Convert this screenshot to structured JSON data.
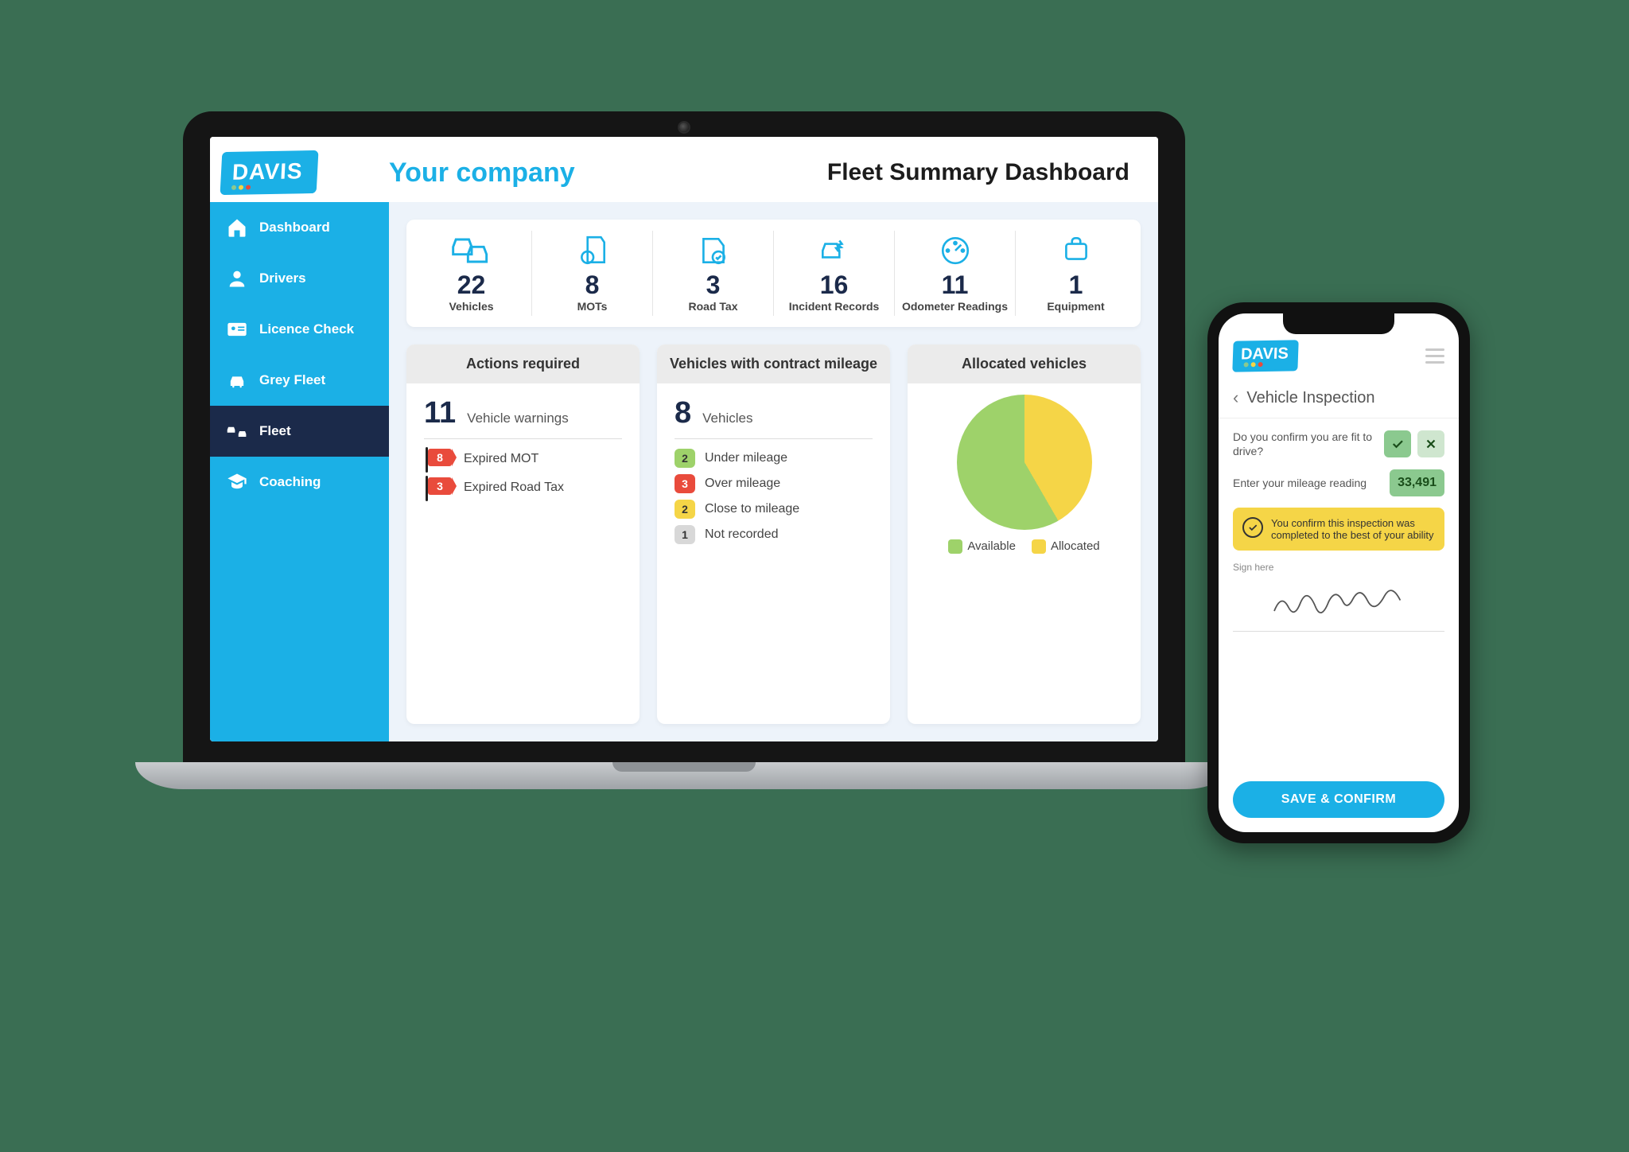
{
  "brand": "DAVIS",
  "header": {
    "company": "Your company",
    "page_title": "Fleet Summary Dashboard"
  },
  "sidebar": {
    "items": [
      {
        "label": "Dashboard",
        "icon": "home"
      },
      {
        "label": "Drivers",
        "icon": "user"
      },
      {
        "label": "Licence Check",
        "icon": "id-card"
      },
      {
        "label": "Grey Fleet",
        "icon": "car"
      },
      {
        "label": "Fleet",
        "icon": "cars",
        "active": true
      },
      {
        "label": "Coaching",
        "icon": "graduation"
      }
    ]
  },
  "stats": [
    {
      "value": "22",
      "label": "Vehicles",
      "icon": "vehicles"
    },
    {
      "value": "8",
      "label": "MOTs",
      "icon": "mot"
    },
    {
      "value": "3",
      "label": "Road Tax",
      "icon": "road-tax"
    },
    {
      "value": "16",
      "label": "Incident Records",
      "icon": "incident"
    },
    {
      "value": "11",
      "label": "Odometer Readings",
      "icon": "odometer"
    },
    {
      "value": "1",
      "label": "Equipment",
      "icon": "equipment"
    }
  ],
  "actions_panel": {
    "title": "Actions required",
    "metric_value": "11",
    "metric_label": "Vehicle warnings",
    "flags": [
      {
        "count": "8",
        "label": "Expired MOT"
      },
      {
        "count": "3",
        "label": "Expired Road Tax"
      }
    ]
  },
  "mileage_panel": {
    "title": "Vehicles with contract mileage",
    "metric_value": "8",
    "metric_label": "Vehicles",
    "rows": [
      {
        "count": "2",
        "color": "green",
        "label": "Under mileage"
      },
      {
        "count": "3",
        "color": "red",
        "label": "Over mileage"
      },
      {
        "count": "2",
        "color": "yellow",
        "label": "Close to mileage"
      },
      {
        "count": "1",
        "color": "grey",
        "label": "Not recorded"
      }
    ]
  },
  "allocated_panel": {
    "title": "Allocated vehicles",
    "legend": [
      {
        "color": "#9ED26A",
        "label": "Available"
      },
      {
        "color": "#F5D547",
        "label": "Allocated"
      }
    ]
  },
  "phone": {
    "title": "Vehicle Inspection",
    "q1": "Do you confirm you are fit to drive?",
    "q2": "Enter your mileage reading",
    "mileage": "33,491",
    "confirm_text": "You confirm this inspection was completed to the best of your ability",
    "sign_label": "Sign here",
    "save_label": "SAVE & CONFIRM"
  },
  "chart_data": {
    "type": "pie",
    "title": "Allocated vehicles",
    "series": [
      {
        "name": "Available",
        "color": "#9ED26A",
        "value": 58
      },
      {
        "name": "Allocated",
        "color": "#F5D547",
        "value": 42
      }
    ]
  }
}
